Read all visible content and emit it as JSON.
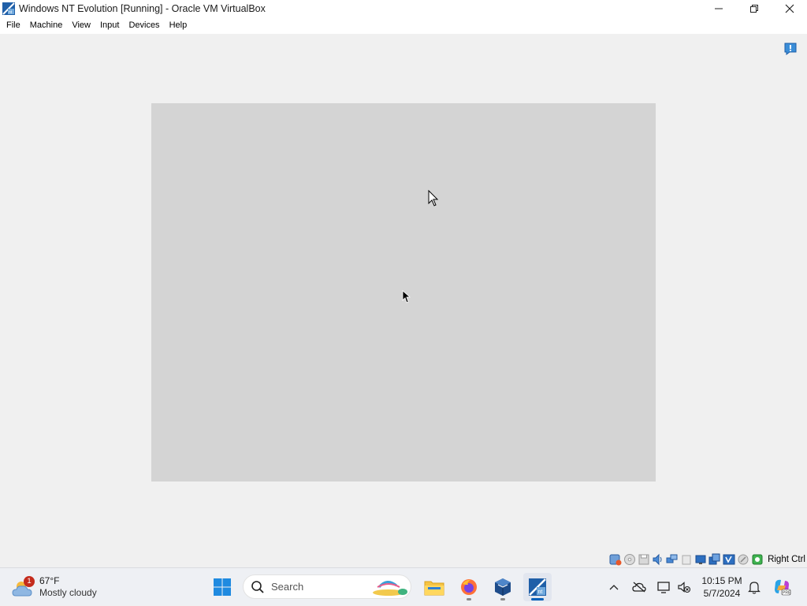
{
  "window": {
    "title": "Windows NT Evolution [Running] - Oracle VM VirtualBox"
  },
  "menu": {
    "items": [
      "File",
      "Machine",
      "View",
      "Input",
      "Devices",
      "Help"
    ]
  },
  "statusbar": {
    "icons": [
      "hard-disk-icon",
      "optical-drive-icon",
      "floppy-drive-icon",
      "audio-icon",
      "network-icon",
      "usb-icon",
      "shared-folders-icon",
      "display-icon",
      "recording-icon",
      "cpu-icon",
      "mouse-integration-icon",
      "keyboard-capture-icon"
    ],
    "host_key": "Right Ctrl"
  },
  "taskbar": {
    "weather": {
      "badge": "1",
      "temperature": "67°F",
      "condition": "Mostly cloudy"
    },
    "search_label": "Search",
    "clock": {
      "time": "10:15 PM",
      "date": "5/7/2024"
    }
  },
  "colors": {
    "window_bg": "#f0f0f0",
    "vm_screen": "#d4d4d4",
    "taskbar_bg": "#eef0f4",
    "accent": "#005fb8"
  }
}
